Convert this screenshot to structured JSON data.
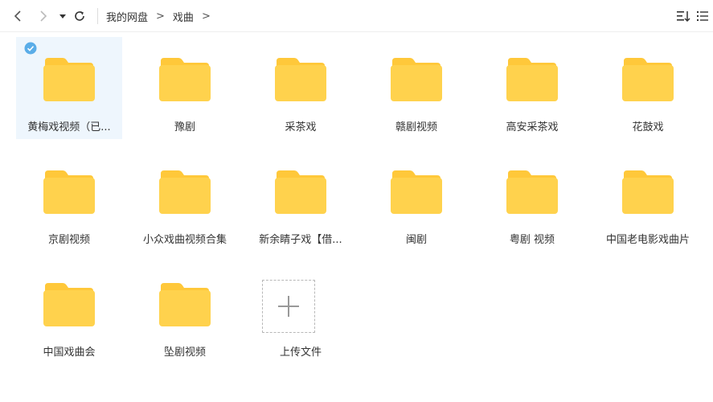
{
  "breadcrumb": {
    "root": "我的网盘",
    "separator": ">",
    "current": "戏曲",
    "trailing_separator": ">"
  },
  "toolbar_icons": [
    "back-arrow-icon",
    "forward-arrow-icon",
    "dropdown-caret-icon",
    "refresh-icon",
    "sort-icon",
    "list-view-icon"
  ],
  "folders": [
    {
      "label": "黄梅戏视频（已...",
      "selected": true
    },
    {
      "label": "豫剧"
    },
    {
      "label": "采茶戏"
    },
    {
      "label": "赣剧视频"
    },
    {
      "label": "高安采茶戏"
    },
    {
      "label": "花鼓戏"
    },
    {
      "label": "京剧视频"
    },
    {
      "label": "小众戏曲视频合集"
    },
    {
      "label": "新余睛子戏【借..."
    },
    {
      "label": "闽剧"
    },
    {
      "label": "粤剧 视频"
    },
    {
      "label": "中国老电影戏曲片"
    },
    {
      "label": "中国戏曲会"
    },
    {
      "label": "坠剧视频"
    }
  ],
  "upload": {
    "label": "上传文件"
  },
  "colors": {
    "folder": "#FFD24D",
    "folder_tab": "#FFC83A",
    "selected_bg": "#EEF6FD",
    "check": "#5AADE8"
  }
}
